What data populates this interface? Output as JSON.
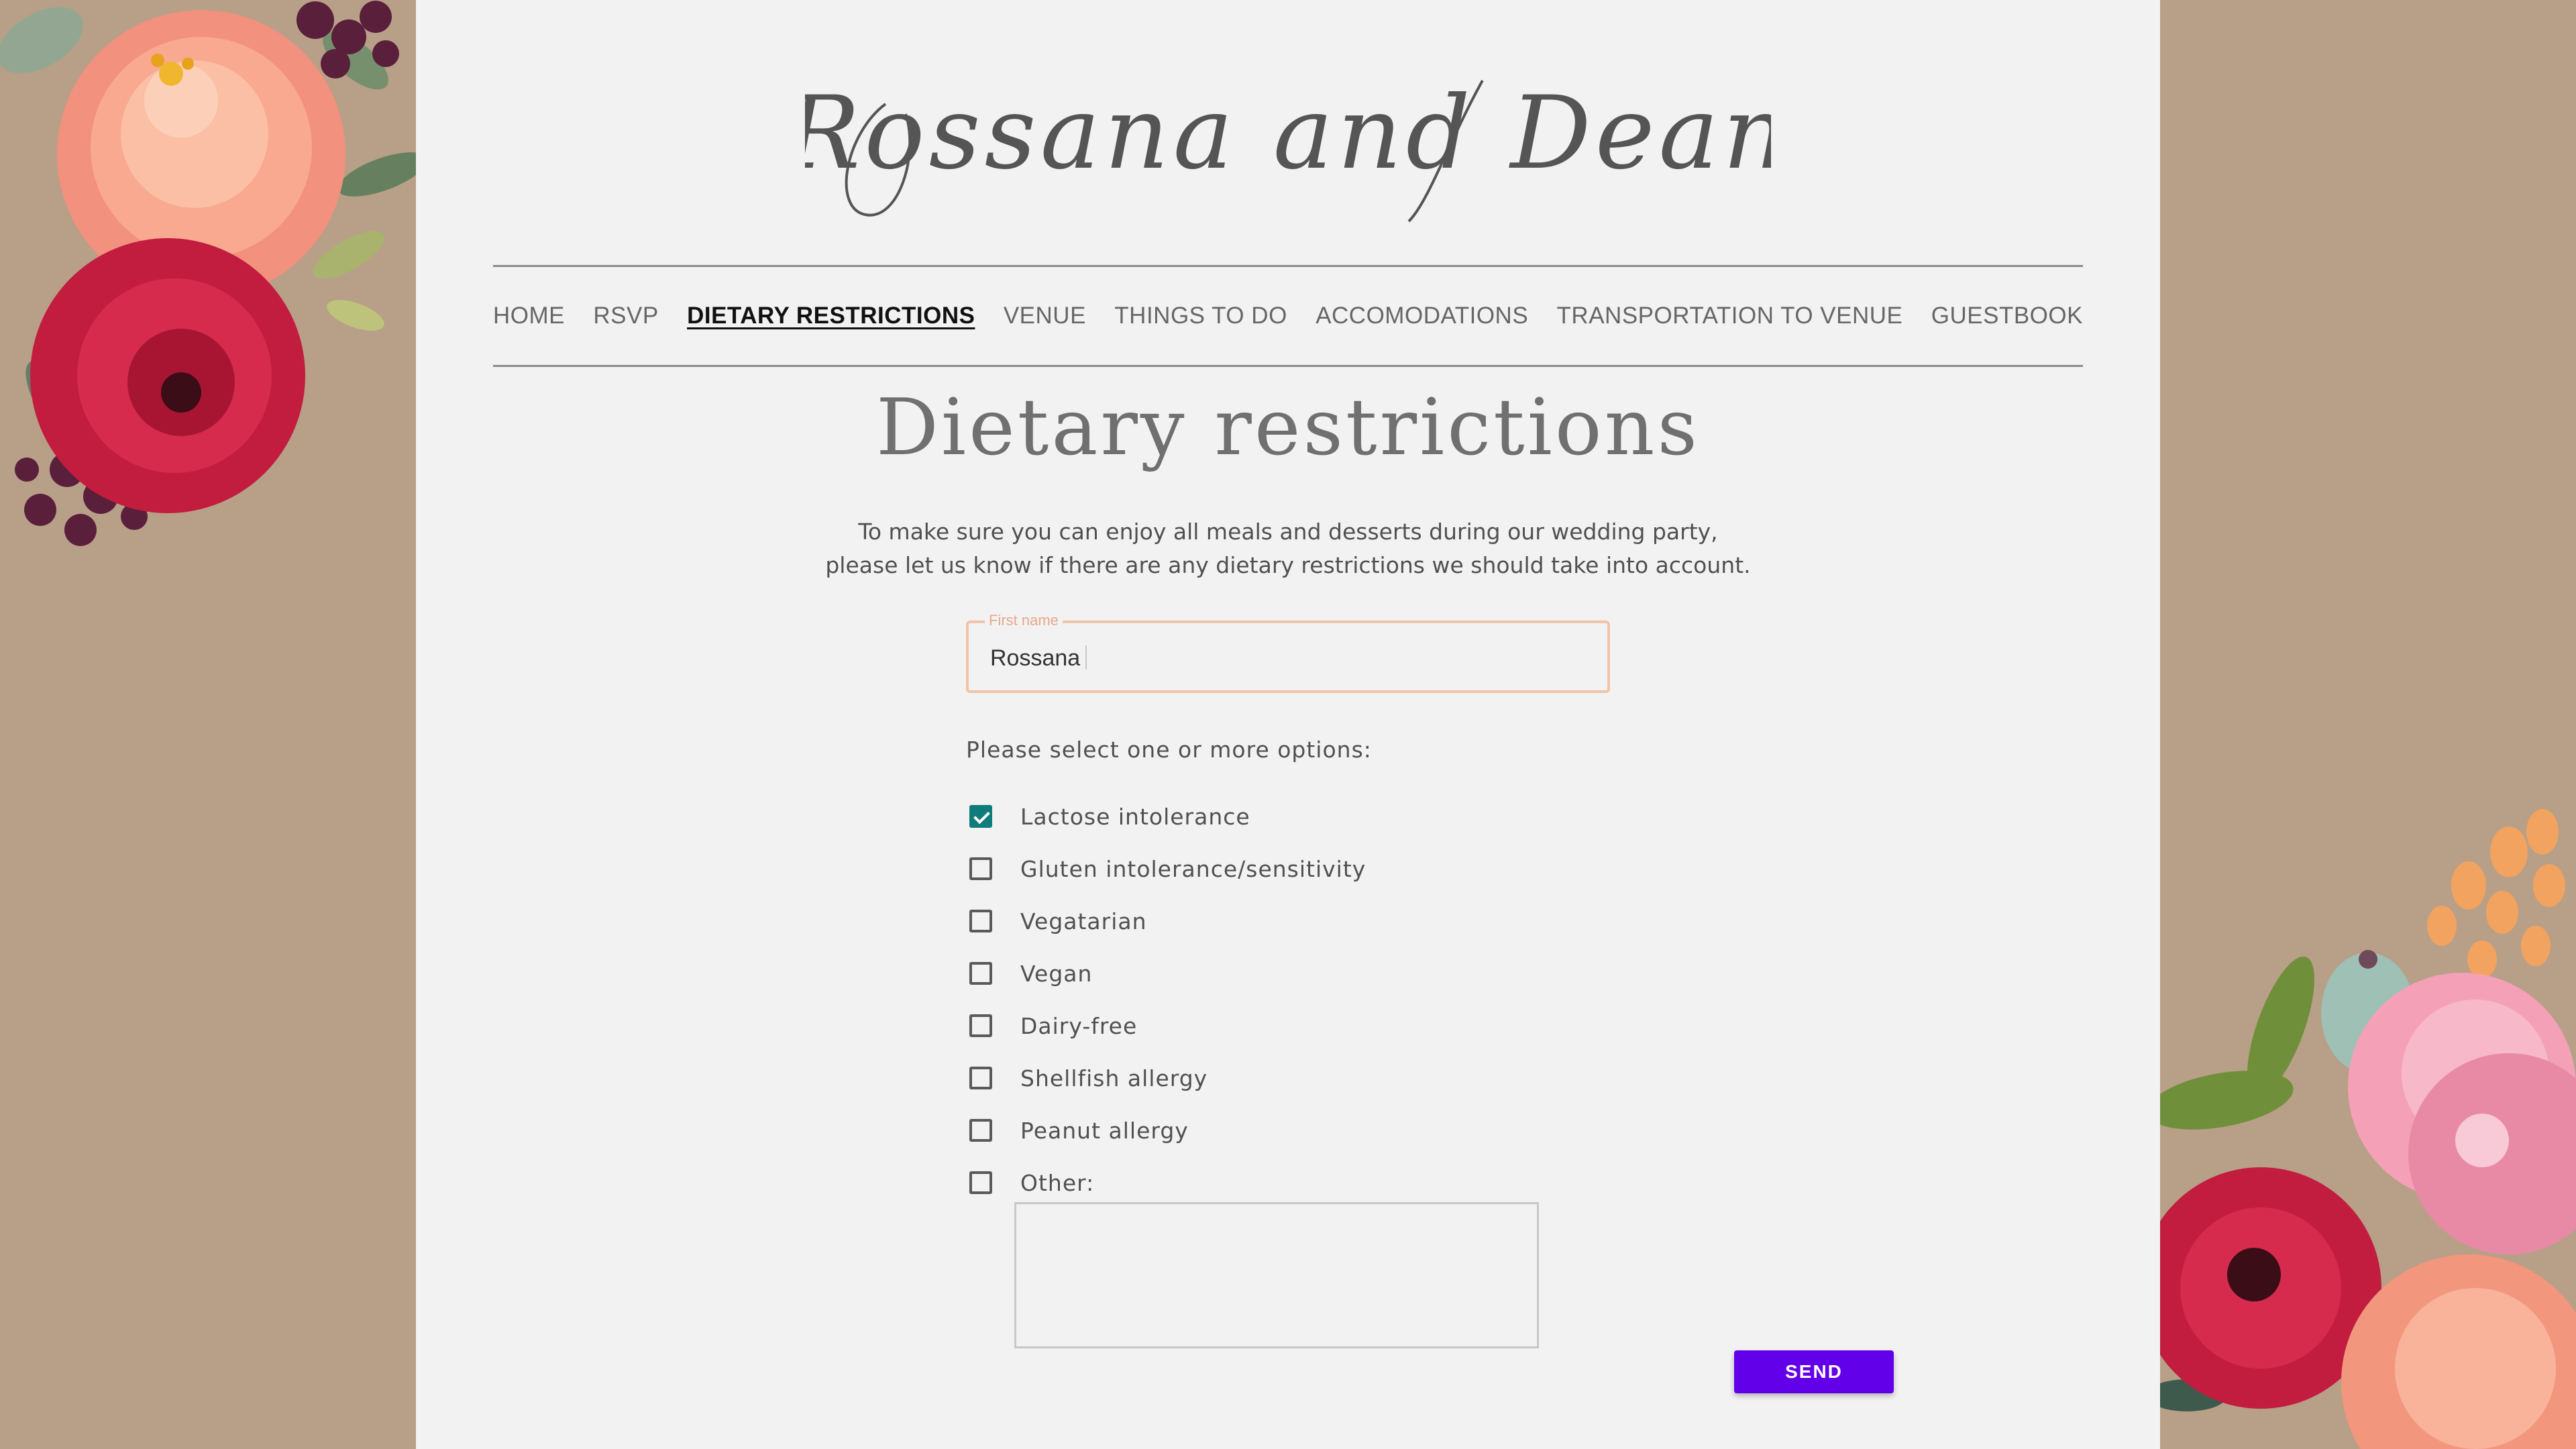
{
  "site": {
    "couple_title": "Rossana and Dean"
  },
  "nav": {
    "items": [
      {
        "label": "HOME",
        "active": false
      },
      {
        "label": "RSVP",
        "active": false
      },
      {
        "label": "DIETARY RESTRICTIONS",
        "active": true
      },
      {
        "label": "VENUE",
        "active": false
      },
      {
        "label": "THINGS TO DO",
        "active": false
      },
      {
        "label": "ACCOMODATIONS",
        "active": false
      },
      {
        "label": "TRANSPORTATION TO VENUE",
        "active": false
      },
      {
        "label": "GUESTBOOK",
        "active": false
      }
    ]
  },
  "page": {
    "heading": "Dietary restrictions",
    "intro_line1": "To make sure you can enjoy all meals and desserts during our wedding party,",
    "intro_line2": "please let us know if there are any dietary restrictions we should take into account."
  },
  "form": {
    "first_name_label": "First name",
    "first_name_value": "Rossana",
    "prompt": "Please select one or more options:",
    "options": [
      {
        "label": "Lactose intolerance",
        "checked": true
      },
      {
        "label": "Gluten intolerance/sensitivity",
        "checked": false
      },
      {
        "label": "Vegatarian",
        "checked": false
      },
      {
        "label": "Vegan",
        "checked": false
      },
      {
        "label": "Dairy-free",
        "checked": false
      },
      {
        "label": "Shellfish allergy",
        "checked": false
      },
      {
        "label": "Peanut allergy",
        "checked": false
      },
      {
        "label": "Other:",
        "checked": false
      }
    ],
    "other_value": "",
    "send_label": "SEND"
  },
  "colors": {
    "background": "#b89f88",
    "card": "#f2f2f2",
    "checkbox_checked": "#0e7c7b",
    "send_button": "#6200ea",
    "field_border": "#f0c4a8"
  }
}
